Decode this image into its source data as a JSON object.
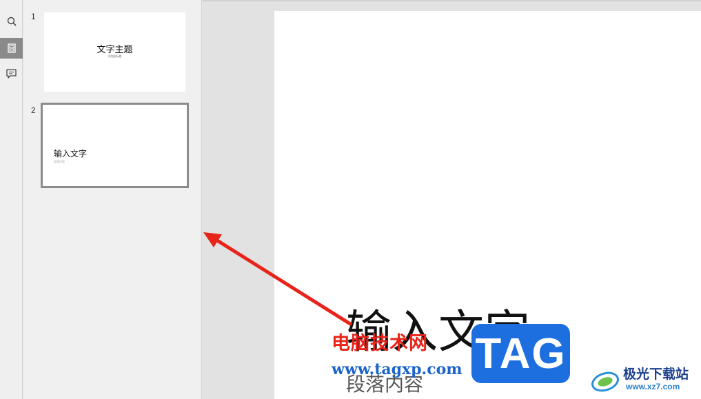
{
  "rail": {
    "items": [
      {
        "icon": "search-icon"
      },
      {
        "icon": "slides-icon",
        "active": true
      },
      {
        "icon": "comment-icon"
      }
    ]
  },
  "thumbnails": [
    {
      "number": "1",
      "title": "文字主题",
      "subtitle": "添加副标题"
    },
    {
      "number": "2",
      "title": "输入文字",
      "subtitle": "段落内容",
      "selected": true
    }
  ],
  "slide": {
    "title": "输入文字",
    "body": "段落内容"
  },
  "watermark": {
    "site_cn": "电脑技术网",
    "url": "www.tagxp.com",
    "tag": "TAG",
    "corner_name": "极光下载站",
    "corner_url": "www.xz7.com"
  },
  "colors": {
    "arrow": "#e8231a",
    "watermark_red": "#e8231a",
    "watermark_blue": "#1d6fe0"
  }
}
